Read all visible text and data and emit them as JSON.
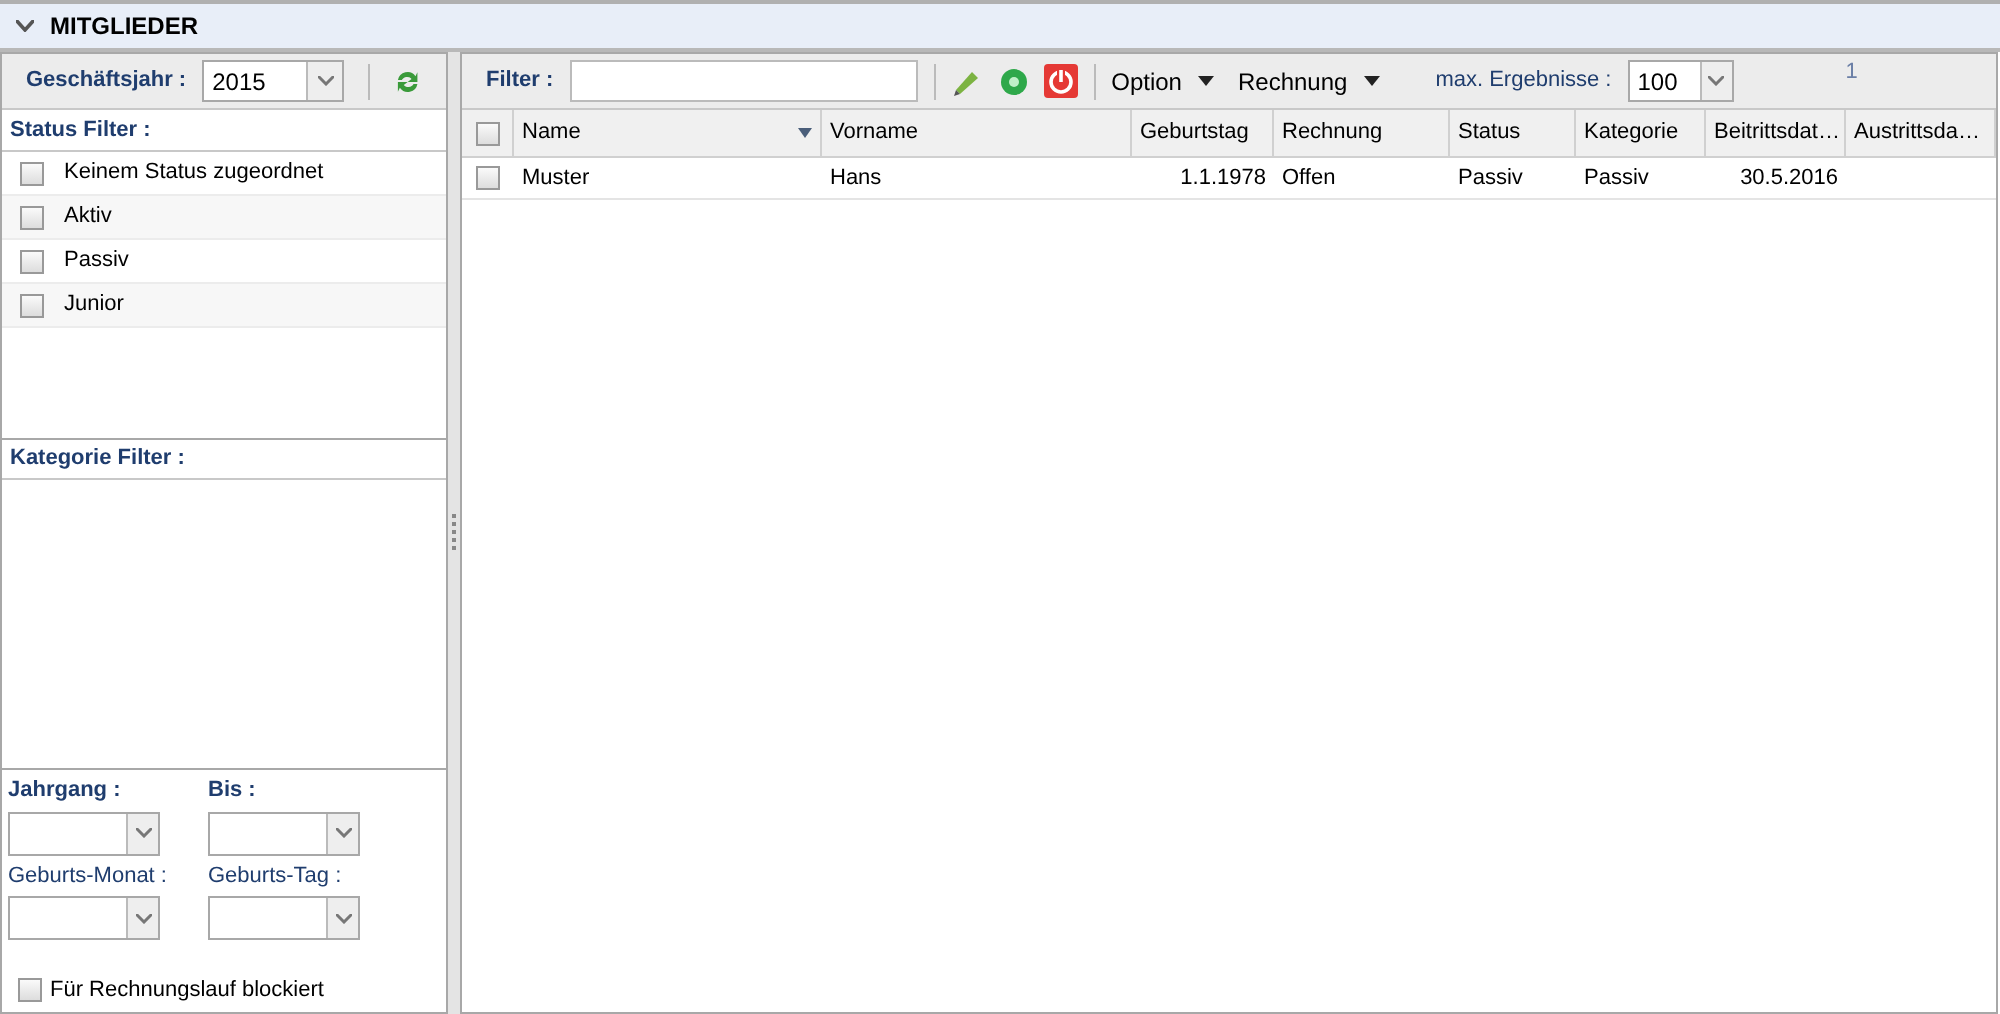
{
  "header": {
    "title": "MITGLIEDER",
    "expanded": true
  },
  "left_panel": {
    "year_label": "Geschäftsjahr :",
    "year_value": "2015",
    "status_filter": {
      "label": "Status Filter :",
      "items": [
        {
          "label": "Keinem Status zugeordnet",
          "checked": false
        },
        {
          "label": "Aktiv",
          "checked": false
        },
        {
          "label": "Passiv",
          "checked": false
        },
        {
          "label": "Junior",
          "checked": false
        }
      ]
    },
    "category_filter": {
      "label": "Kategorie Filter :"
    },
    "selects": [
      {
        "label": "Jahrgang :",
        "bold": true
      },
      {
        "label": "Bis :",
        "bold": true
      },
      {
        "label": "Geburts-Monat :",
        "bold": false
      },
      {
        "label": "Geburts-Tag :",
        "bold": false
      }
    ],
    "blocked": {
      "label": "Für Rechnungslauf blockiert",
      "checked": false
    }
  },
  "toolbar": {
    "filter_label": "Filter :",
    "menus": [
      "Option",
      "Rechnung"
    ],
    "max_label": "max. Ergebnisse :",
    "max_value": "100",
    "count": "1"
  },
  "table": {
    "all_checked": false,
    "columns": [
      {
        "label": "Name",
        "sorted": true,
        "kind": "text"
      },
      {
        "label": "Vorname",
        "sorted": false,
        "kind": "text"
      },
      {
        "label": "Geburtstag",
        "sorted": false,
        "kind": "date"
      },
      {
        "label": "Rechnung",
        "sorted": false,
        "kind": "text"
      },
      {
        "label": "Status",
        "sorted": false,
        "kind": "text"
      },
      {
        "label": "Kategorie",
        "sorted": false,
        "kind": "text"
      },
      {
        "label": "Beitrittsdat…",
        "sorted": false,
        "kind": "date"
      },
      {
        "label": "Austrittsda…",
        "sorted": false,
        "kind": "text"
      }
    ],
    "rows": [
      {
        "checked": false,
        "cells": [
          "Muster",
          "Hans",
          "1.1.1978",
          "Offen",
          "Passiv",
          "Passiv",
          "30.5.2016",
          ""
        ]
      }
    ]
  }
}
